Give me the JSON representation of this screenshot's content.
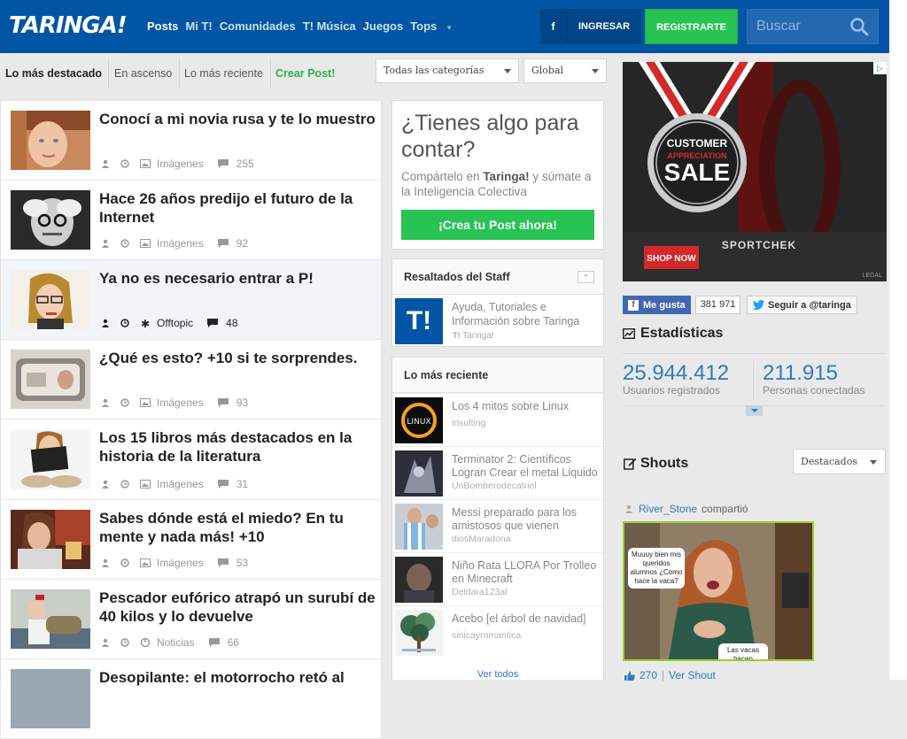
{
  "header": {
    "logo": "TARINGA!",
    "nav": [
      {
        "label": "Posts",
        "active": true
      },
      {
        "label": "Mi T!",
        "active": false
      },
      {
        "label": "Comunidades",
        "active": false
      },
      {
        "label": "T! Música",
        "active": false
      },
      {
        "label": "Juegos",
        "active": false
      },
      {
        "label": "Tops",
        "active": false
      }
    ],
    "facebook_label": "f",
    "login_label": "INGRESAR",
    "register_label": "REGISTRARTE",
    "search_placeholder": "Buscar"
  },
  "filters": {
    "tabs": [
      "Lo más destacado",
      "En ascenso",
      "Lo más reciente",
      "Crear Post!"
    ],
    "category_select": "Todas las categorías",
    "scope_select": "Global"
  },
  "posts": [
    {
      "title": "Conocí a mi novia rusa y te lo muestro",
      "category": "Imágenes",
      "comments": "255",
      "category_icon": "image-icon"
    },
    {
      "title": "Hace 26 años predijo el futuro de la Internet",
      "category": "Imágenes",
      "comments": "92",
      "category_icon": "image-icon"
    },
    {
      "title": "Ya no es necesario entrar a P!",
      "category": "Offtopic",
      "comments": "48",
      "category_icon": "asterisk-icon"
    },
    {
      "title": "¿Qué es esto? +10 si te sorprendes.",
      "category": "Imágenes",
      "comments": "93",
      "category_icon": "image-icon"
    },
    {
      "title": "Los 15 libros más destacados en la historia de la literatura",
      "category": "Imágenes",
      "comments": "31",
      "category_icon": "image-icon"
    },
    {
      "title": "Sabes dónde está el miedo? En tu mente y nada más! +10",
      "category": "Imágenes",
      "comments": "53",
      "category_icon": "image-icon"
    },
    {
      "title": "Pescador eufórico atrapó un surubí de 40 kilos y lo devuelve",
      "category": "Noticias",
      "comments": "66",
      "category_icon": "news-icon"
    },
    {
      "title": "Desopilante: el motorrocho retó al",
      "category": "",
      "comments": "",
      "category_icon": ""
    }
  ],
  "cta": {
    "heading": "¿Tienes algo para contar?",
    "text_pre": "Compártelo en ",
    "text_brand": "Taringa!",
    "text_post": " y súmate a la Inteligencia Colectiva",
    "button": "¡Crea tu Post ahora!"
  },
  "staff": {
    "title": "Resaltados del Staff",
    "minimize": "-",
    "item": {
      "logo": "T!",
      "text": "Ayuda, Tutoriales e Información sobre Taringa",
      "source": "Taringa!"
    }
  },
  "recent": {
    "title": "Lo más reciente",
    "items": [
      {
        "text": "Los 4 mitos sobre Linux",
        "user": "insulting"
      },
      {
        "text": "Terminator 2: Científicos Logran Crear el metal Liquido",
        "user": "UnBomberodecatriel"
      },
      {
        "text": "Messi preparado para los amistosos que vienen",
        "user": "diosMaradona"
      },
      {
        "text": "Niño Rata LLORA Por Trolleo en Minecraft",
        "user": "Deidara123al"
      },
      {
        "text": "Acebo [el árbol de navidad]",
        "user": "sinicayromantica"
      }
    ],
    "see_all": "Ver todos",
    "linux_badge": "LINUX"
  },
  "ad": {
    "line1": "CUSTOMER",
    "line2": "APPRECIATION",
    "line3": "SALE",
    "brand": "SPORTCHEK",
    "button": "SHOP NOW",
    "legal": "LEGAL",
    "flag": "▷"
  },
  "social": {
    "fb_like": "Me gusta",
    "fb_count": "381 971",
    "twitter_follow": "Seguir a @taringa"
  },
  "stats": {
    "title": "Estadísticas",
    "registered_value": "25.944.412",
    "registered_label": "Usuarios registrados",
    "online_value": "211.915",
    "online_label": "Personas conectadas"
  },
  "shouts": {
    "title": "Shouts",
    "sort": "Destacados",
    "user": "River_Stone",
    "action": "compartió",
    "bubble1": "Muuuy bien mis queridos alumnos ¿Como hace la vaca?",
    "bubble2": "Las vacas hacen",
    "likes": "270",
    "see_shout": "Ver Shout"
  },
  "colors": {
    "brand_blue": "#0055a4",
    "green": "#27c353",
    "link_blue": "#2c7bc2"
  }
}
